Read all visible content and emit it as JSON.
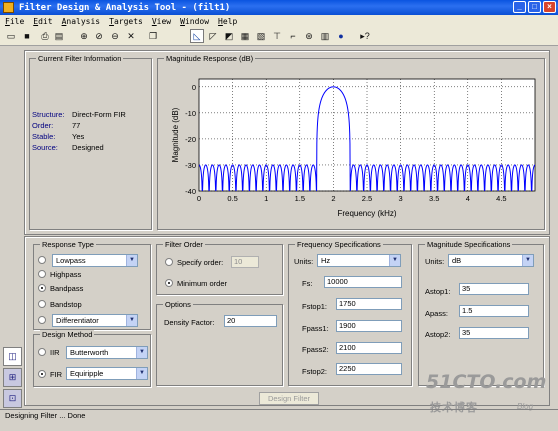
{
  "window": {
    "title": "Filter Design & Analysis Tool -  (filt1)"
  },
  "menu": [
    "File",
    "Edit",
    "Analysis",
    "Targets",
    "View",
    "Window",
    "Help"
  ],
  "current_filter": {
    "title": "Current Filter Information",
    "rows": [
      {
        "label": "Structure:",
        "value": "Direct-Form FIR"
      },
      {
        "label": "Order:",
        "value": "77"
      },
      {
        "label": "Stable:",
        "value": "Yes"
      },
      {
        "label": "Source:",
        "value": "Designed"
      }
    ]
  },
  "plot": {
    "panel_title": "Magnitude Response (dB)",
    "chart_data": {
      "type": "line",
      "xlabel": "Frequency (kHz)",
      "ylabel": "Magnitude (dB)",
      "xlim": [
        0,
        5
      ],
      "ylim": [
        -40,
        3
      ],
      "xticks": [
        "0",
        "0.5",
        "1",
        "1.5",
        "2",
        "2.5",
        "3",
        "3.5",
        "4",
        "4.5"
      ],
      "yticks": [
        "0",
        "-10",
        "-20",
        "-30",
        "-40"
      ],
      "grid": true,
      "passband": [
        1.9,
        2.1
      ],
      "stopband_edges": [
        1.75,
        2.25
      ],
      "stopband_level": -30,
      "peak": 0,
      "line_color": "#0000ff"
    }
  },
  "response_type": {
    "title": "Response Type",
    "options": [
      {
        "label": "Lowpass",
        "dropdown": true,
        "selected": false
      },
      {
        "label": "Highpass",
        "selected": false
      },
      {
        "label": "Bandpass",
        "selected": true
      },
      {
        "label": "Bandstop",
        "selected": false
      },
      {
        "label": "Differentiator",
        "dropdown": true,
        "selected": false
      }
    ]
  },
  "design_method": {
    "title": "Design Method",
    "iir": {
      "label": "IIR",
      "value": "Butterworth",
      "selected": false
    },
    "fir": {
      "label": "FIR",
      "value": "Equiripple",
      "selected": true
    }
  },
  "filter_order": {
    "title": "Filter Order",
    "specify": {
      "label": "Specify order:",
      "value": "10",
      "selected": false
    },
    "minimum": {
      "label": "Minimum order",
      "selected": true
    }
  },
  "options": {
    "title": "Options",
    "density_label": "Density Factor:",
    "density_value": "20"
  },
  "freq_spec": {
    "title": "Frequency Specifications",
    "units_label": "Units:",
    "units_value": "Hz",
    "fields": [
      {
        "label": "Fs:",
        "value": "10000"
      },
      {
        "label": "Fstop1:",
        "value": "1750"
      },
      {
        "label": "Fpass1:",
        "value": "1900"
      },
      {
        "label": "Fpass2:",
        "value": "2100"
      },
      {
        "label": "Fstop2:",
        "value": "2250"
      }
    ]
  },
  "mag_spec": {
    "title": "Magnitude Specifications",
    "units_label": "Units:",
    "units_value": "dB",
    "fields": [
      {
        "label": "Astop1:",
        "value": "35"
      },
      {
        "label": "Apass:",
        "value": "1.5"
      },
      {
        "label": "Astop2:",
        "value": "35"
      }
    ]
  },
  "design_button": "Design Filter",
  "status": "Designing Filter ... Done",
  "watermark": {
    "site": "51CTO.com",
    "cn": "技术博客",
    "blog": "Blog"
  }
}
